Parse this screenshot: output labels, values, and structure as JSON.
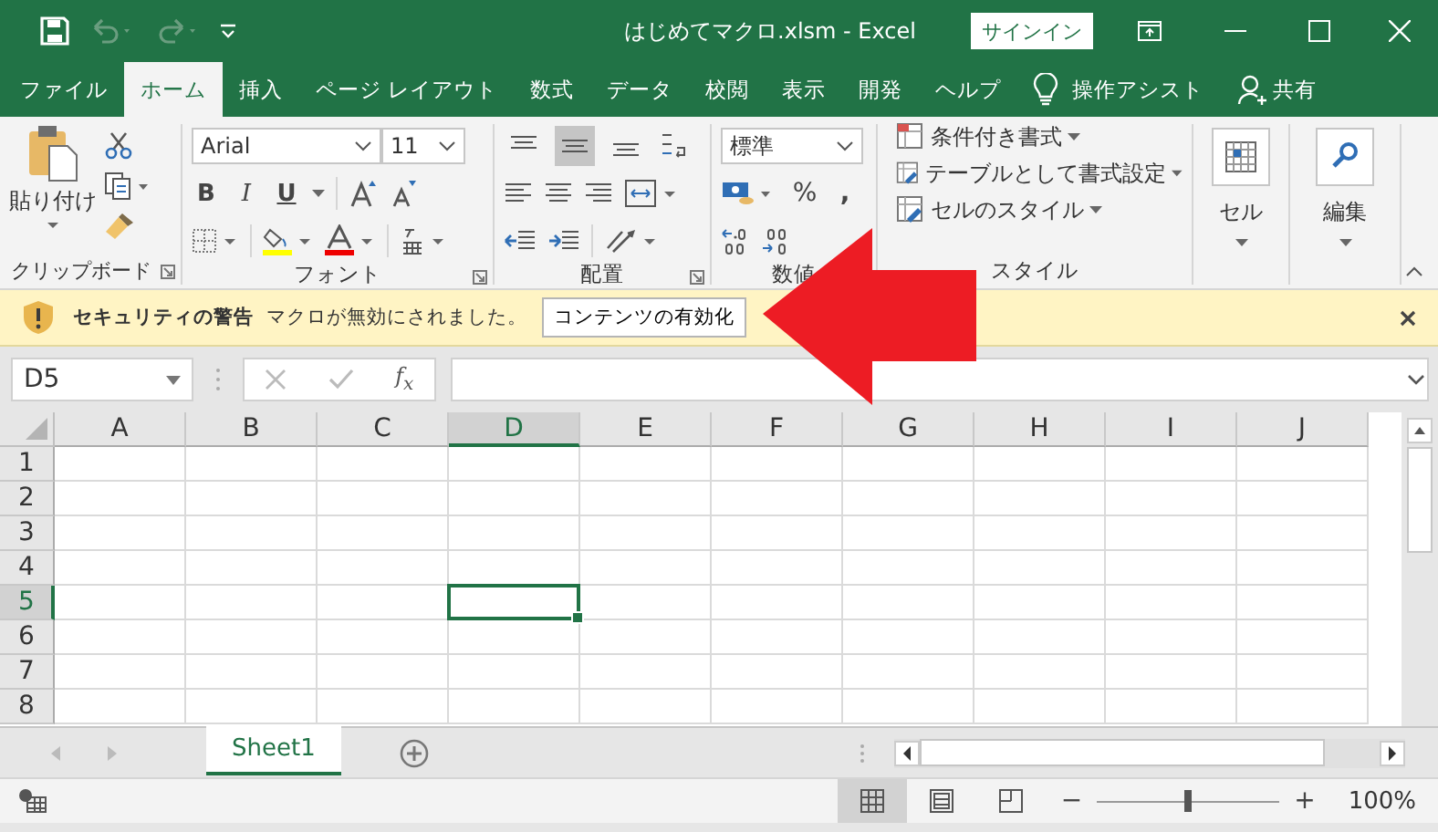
{
  "title_bar": {
    "title": "はじめてマクロ.xlsm  -  Excel",
    "sign_in": "サインイン"
  },
  "ribbon_tabs": [
    {
      "label": "ファイル",
      "selected": false
    },
    {
      "label": "ホーム",
      "selected": true
    },
    {
      "label": "挿入",
      "selected": false
    },
    {
      "label": "ページ レイアウト",
      "selected": false
    },
    {
      "label": "数式",
      "selected": false
    },
    {
      "label": "データ",
      "selected": false
    },
    {
      "label": "校閲",
      "selected": false
    },
    {
      "label": "表示",
      "selected": false
    },
    {
      "label": "開発",
      "selected": false
    },
    {
      "label": "ヘルプ",
      "selected": false
    }
  ],
  "tell_me": "操作アシスト",
  "share": "共有",
  "ribbon": {
    "clipboard": {
      "paste": "貼り付け",
      "label": "クリップボード"
    },
    "font": {
      "name": "Arial",
      "size": "11",
      "bold": "B",
      "italic": "I",
      "underline": "U",
      "label": "フォント"
    },
    "alignment": {
      "vertical": [
        {
          "kind": "top",
          "selected": false
        },
        {
          "kind": "middle",
          "selected": true
        },
        {
          "kind": "bottom",
          "selected": false
        }
      ],
      "label": "配置"
    },
    "number": {
      "format": "標準",
      "percent": "%",
      "comma": ",",
      "label": "数値"
    },
    "styles": {
      "items": [
        "条件付き書式",
        "テーブルとして書式設定",
        "セルのスタイル"
      ],
      "label": "スタイル"
    },
    "cells": {
      "label": "セル"
    },
    "editing": {
      "label": "編集"
    }
  },
  "security_bar": {
    "title": "セキュリティの警告",
    "message": "マクロが無効にされました。",
    "button": "コンテンツの有効化"
  },
  "formula_bar": {
    "name_box": "D5",
    "fx": "f$_{x}$"
  },
  "sheet": {
    "columns": [
      {
        "label": "A",
        "selected": false
      },
      {
        "label": "B",
        "selected": false
      },
      {
        "label": "C",
        "selected": false
      },
      {
        "label": "D",
        "selected": true
      },
      {
        "label": "E",
        "selected": false
      },
      {
        "label": "F",
        "selected": false
      },
      {
        "label": "G",
        "selected": false
      },
      {
        "label": "H",
        "selected": false
      },
      {
        "label": "I",
        "selected": false
      },
      {
        "label": "J",
        "selected": false
      }
    ],
    "rows": [
      {
        "label": "1",
        "selected": false
      },
      {
        "label": "2",
        "selected": false
      },
      {
        "label": "3",
        "selected": false
      },
      {
        "label": "4",
        "selected": false
      },
      {
        "label": "5",
        "selected": true
      },
      {
        "label": "6",
        "selected": false
      },
      {
        "label": "7",
        "selected": false
      },
      {
        "label": "8",
        "selected": false
      }
    ]
  },
  "sheet_tabs": [
    {
      "label": "Sheet1",
      "selected": true
    }
  ],
  "status_bar": {
    "views": [
      {
        "kind": "normal",
        "selected": true
      },
      {
        "kind": "page_layout",
        "selected": false
      },
      {
        "kind": "page_break",
        "selected": false
      }
    ],
    "zoom": {
      "minus": "−",
      "plus": "+",
      "level": 0.5,
      "reading": "100%"
    }
  }
}
